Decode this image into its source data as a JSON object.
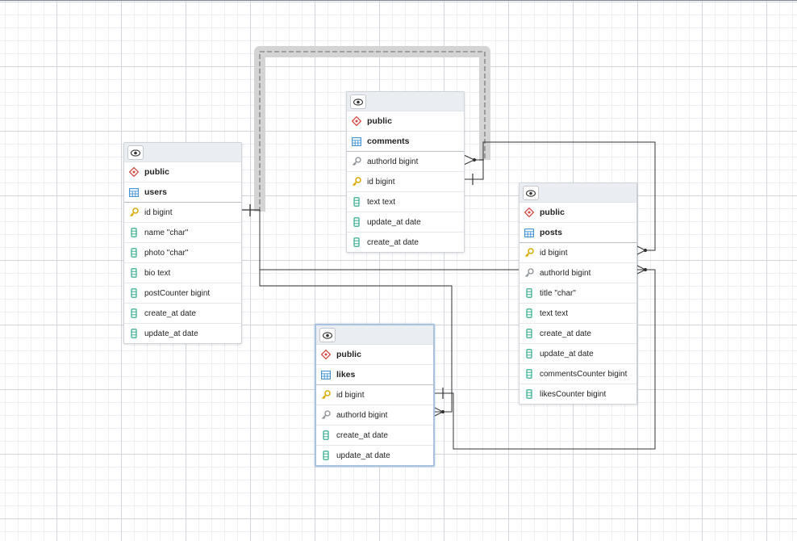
{
  "tables": {
    "users": {
      "schema": "public",
      "name": "users",
      "columns": [
        {
          "label": "id bigint",
          "icon": "primary-key-icon"
        },
        {
          "label": "name \"char\"",
          "icon": "column-icon"
        },
        {
          "label": "photo \"char\"",
          "icon": "column-icon"
        },
        {
          "label": "bio text",
          "icon": "column-icon"
        },
        {
          "label": "postCounter bigint",
          "icon": "column-icon"
        },
        {
          "label": "create_at date",
          "icon": "column-icon"
        },
        {
          "label": "update_at date",
          "icon": "column-icon"
        }
      ]
    },
    "comments": {
      "schema": "public",
      "name": "comments",
      "columns": [
        {
          "label": "authorId bigint",
          "icon": "foreign-key-icon"
        },
        {
          "label": "id bigint",
          "icon": "primary-key-icon"
        },
        {
          "label": "text text",
          "icon": "column-icon"
        },
        {
          "label": "update_at date",
          "icon": "column-icon"
        },
        {
          "label": "create_at date",
          "icon": "column-icon"
        }
      ]
    },
    "posts": {
      "schema": "public",
      "name": "posts",
      "columns": [
        {
          "label": "id bigint",
          "icon": "primary-key-icon"
        },
        {
          "label": "authorId bigint",
          "icon": "foreign-key-icon"
        },
        {
          "label": "title \"char\"",
          "icon": "column-icon"
        },
        {
          "label": "text text",
          "icon": "column-icon"
        },
        {
          "label": "create_at date",
          "icon": "column-icon"
        },
        {
          "label": "update_at date",
          "icon": "column-icon"
        },
        {
          "label": "commentsCounter bigint",
          "icon": "column-icon"
        },
        {
          "label": "likesCounter bigint",
          "icon": "column-icon"
        }
      ]
    },
    "likes": {
      "schema": "public",
      "name": "likes",
      "selected": true,
      "columns": [
        {
          "label": "id bigint",
          "icon": "primary-key-icon"
        },
        {
          "label": "authorId bigint",
          "icon": "foreign-key-icon"
        },
        {
          "label": "create_at date",
          "icon": "column-icon"
        },
        {
          "label": "update_at date",
          "icon": "column-icon"
        }
      ]
    }
  },
  "colors": {
    "schema_icon": "#d0473f",
    "table_icon": "#3f8fd2",
    "primary_key": "#d9a900",
    "foreign_key": "#8a8f96",
    "column_icon": "#1fa383",
    "edge": "#333333",
    "highlight": "#d4d4d4"
  }
}
